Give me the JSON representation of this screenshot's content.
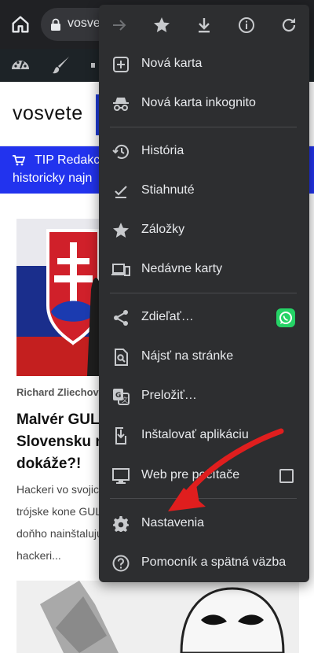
{
  "browser": {
    "url_text": "vosve",
    "icons": [
      "home-icon",
      "lock-icon"
    ]
  },
  "wp_toolbar": {
    "icons": [
      "dashboard-icon",
      "customize-brush-icon",
      "extra-icon"
    ]
  },
  "site": {
    "title": "vosvete"
  },
  "tip_banner": {
    "line1": "TIP Redakc",
    "line2": "historicky najn",
    "icon": "cart-icon"
  },
  "article": {
    "byline": "Richard Zliechov",
    "headline_lines": [
      "Malvér GULo",
      "Slovensku n",
      "dokáže?!"
    ],
    "excerpt_lines": [
      "Hackeri vo svojic",
      "trójske kone GUL",
      "doňho nainštalujú",
      "hackeri..."
    ]
  },
  "menu": {
    "toolbar": [
      {
        "name": "forward",
        "icon": "arrow-forward-icon",
        "enabled": false
      },
      {
        "name": "bookmark",
        "icon": "star-icon",
        "enabled": true
      },
      {
        "name": "download",
        "icon": "download-icon",
        "enabled": true
      },
      {
        "name": "info",
        "icon": "info-icon",
        "enabled": true
      },
      {
        "name": "refresh",
        "icon": "refresh-icon",
        "enabled": true
      }
    ],
    "items": [
      {
        "label": "Nová karta",
        "icon": "new-tab-icon"
      },
      {
        "label": "Nová karta inkognito",
        "icon": "incognito-icon"
      },
      {
        "label": "História",
        "icon": "history-icon"
      },
      {
        "label": "Stiahnuté",
        "icon": "downloads-check-icon"
      },
      {
        "label": "Záložky",
        "icon": "bookmarks-star-icon"
      },
      {
        "label": "Nedávne karty",
        "icon": "recent-tabs-icon"
      },
      {
        "label": "Zdieľať…",
        "icon": "share-icon"
      },
      {
        "label": "Nájsť na stránke",
        "icon": "find-in-page-icon"
      },
      {
        "label": "Preložiť…",
        "icon": "translate-icon"
      },
      {
        "label": "Inštalovať aplikáciu",
        "icon": "install-app-icon"
      },
      {
        "label": "Web pre počítače",
        "icon": "desktop-site-icon"
      },
      {
        "label": "Nastavenia",
        "icon": "settings-gear-icon"
      },
      {
        "label": "Pomocník a spätná väzba",
        "icon": "help-icon"
      }
    ],
    "desktop_site_checked": false,
    "share_target_icon": "whatsapp-icon"
  },
  "colors": {
    "menu_bg": "#2d2e30",
    "menu_text": "#e8eaed",
    "banner": "#2233ee",
    "annotation_arrow": "#e01e1e"
  }
}
